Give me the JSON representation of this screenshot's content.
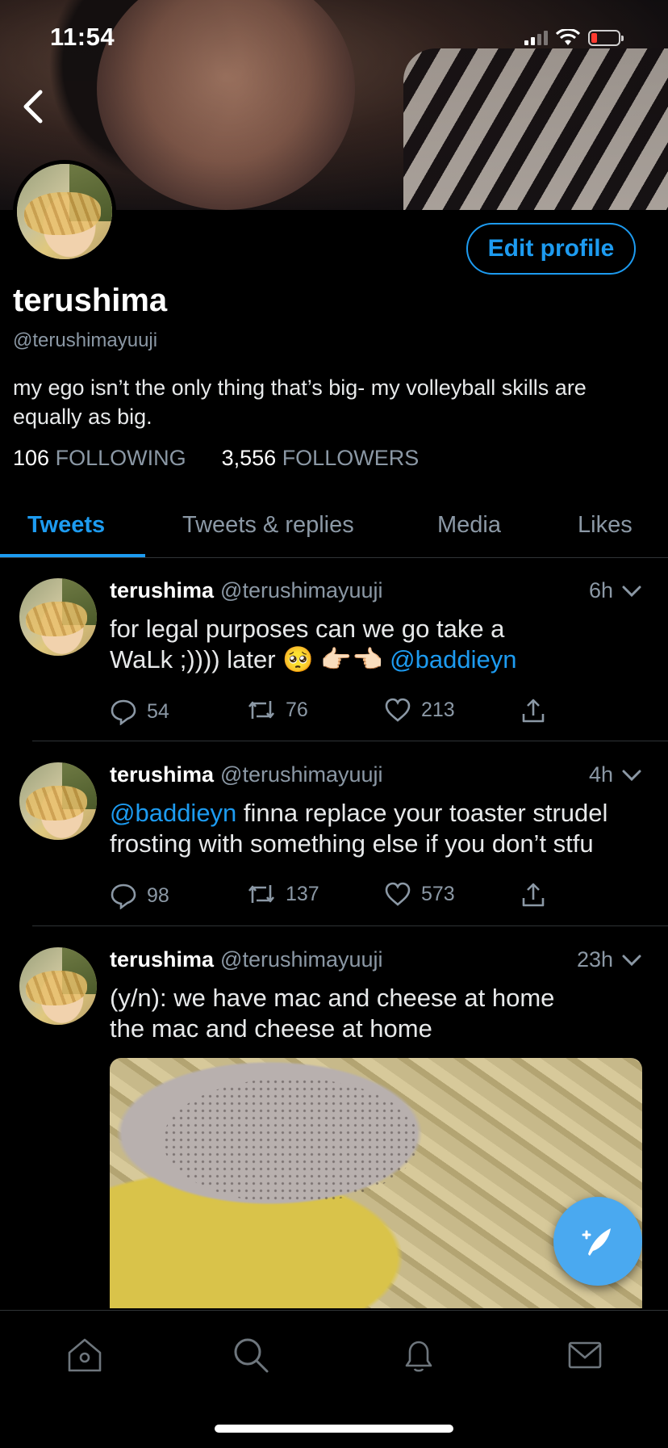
{
  "status_bar": {
    "time": "11:54"
  },
  "profile": {
    "display_name": "terushima",
    "handle": "@terushimayuuji",
    "bio": "my ego isn’t the only thing that’s big- my volleyball skills are equally as big.",
    "edit_button": "Edit profile",
    "following_count": "106",
    "following_label": "FOLLOWING",
    "followers_count": "3,556",
    "followers_label": "FOLLOWERS"
  },
  "tabs": [
    {
      "label": "Tweets",
      "active": true
    },
    {
      "label": "Tweets & replies",
      "active": false
    },
    {
      "label": "Media",
      "active": false
    },
    {
      "label": "Likes",
      "active": false
    }
  ],
  "tweets": [
    {
      "name": "terushima",
      "handle": "@terushimayuuji",
      "time": "6h",
      "text_line1": "for legal purposes can we go take a",
      "text_line2_pre": "WaLk ;)))) later 🥺 👉🏻👈🏻 ",
      "text_line2_mention": "@baddieyn",
      "replies": "54",
      "retweets": "76",
      "likes": "213"
    },
    {
      "name": "terushima",
      "handle": "@terushimayuuji",
      "time": "4h",
      "mention": "@baddieyn",
      "text_rest": " finna replace your toaster strudel frosting with something else if you don’t stfu",
      "replies": "98",
      "retweets": "137",
      "likes": "573"
    },
    {
      "name": "terushima",
      "handle": "@terushimayuuji",
      "time": "23h",
      "text_line1": "(y/n): we have mac and cheese at home",
      "text_line2": "the mac and cheese at home"
    }
  ],
  "icons": {
    "back": "chevron-left-icon",
    "reply": "reply-icon",
    "retweet": "retweet-icon",
    "like": "heart-icon",
    "share": "share-icon",
    "compose": "compose-icon",
    "home": "home-icon",
    "search": "search-icon",
    "notifications": "bell-icon",
    "messages": "mail-icon"
  },
  "colors": {
    "accent": "#1d9bf0",
    "muted": "#8b98a5",
    "background": "#000000"
  }
}
